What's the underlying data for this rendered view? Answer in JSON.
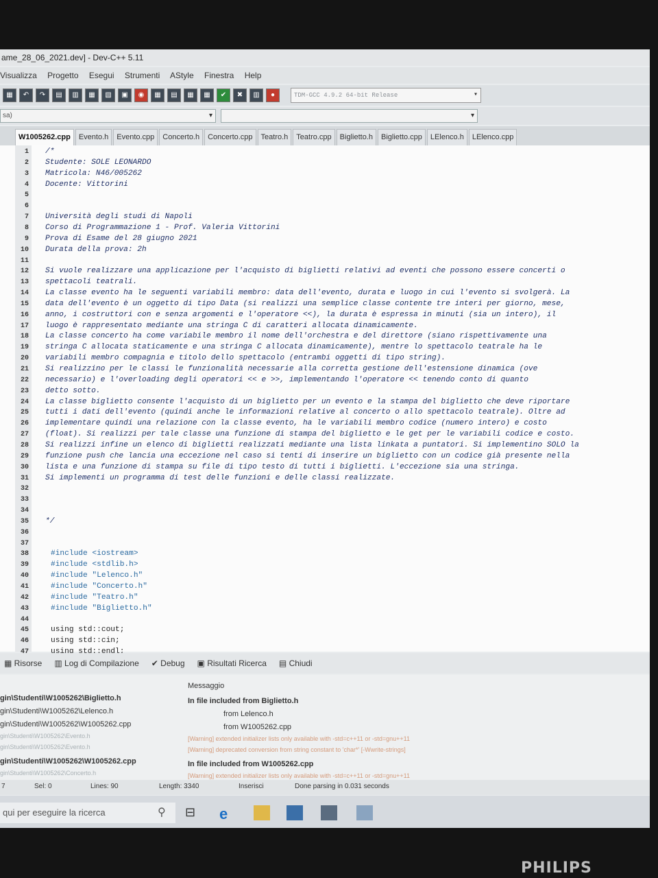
{
  "window": {
    "title": "ame_28_06_2021.dev] - Dev-C++ 5.11"
  },
  "menu": [
    "Visualizza",
    "Progetto",
    "Esegui",
    "Strumenti",
    "AStyle",
    "Finestra",
    "Help"
  ],
  "toolbar": {
    "compiler": "TDM-GCC 4.9.2 64-bit Release"
  },
  "selector": {
    "left_value": "sa)"
  },
  "tabs": [
    "W1005262.cpp",
    "Evento.h",
    "Evento.cpp",
    "Concerto.h",
    "Concerto.cpp",
    "Teatro.h",
    "Teatro.cpp",
    "Biglietto.h",
    "Biglietto.cpp",
    "LElenco.h",
    "LElenco.cpp"
  ],
  "editor": {
    "lines": [
      {
        "n": "1",
        "text": "/*"
      },
      {
        "n": "2",
        "text": "Studente: SOLE LEONARDO"
      },
      {
        "n": "3",
        "text": "Matricola: N46/005262"
      },
      {
        "n": "4",
        "text": "Docente: Vittorini"
      },
      {
        "n": "5",
        "text": ""
      },
      {
        "n": "6",
        "text": ""
      },
      {
        "n": "7",
        "text": "Università degli studi di Napoli"
      },
      {
        "n": "8",
        "text": "Corso di Programmazione 1 - Prof. Valeria Vittorini"
      },
      {
        "n": "9",
        "text": "Prova di Esame del 28 giugno 2021"
      },
      {
        "n": "10",
        "text": "Durata della prova: 2h"
      },
      {
        "n": "11",
        "text": ""
      },
      {
        "n": "12",
        "text": "Si vuole realizzare una applicazione per l'acquisto di biglietti relativi ad eventi che possono essere concerti o"
      },
      {
        "n": "13",
        "text": "spettacoli teatrali."
      },
      {
        "n": "14",
        "text": "La classe evento ha le seguenti variabili membro: data dell'evento, durata e luogo in cui l'evento si svolgerà. La"
      },
      {
        "n": "15",
        "text": "data dell'evento è un oggetto di tipo Data (si realizzi una semplice classe contente tre interi per giorno, mese,"
      },
      {
        "n": "16",
        "text": "anno, i costruttori con e senza argomenti e l'operatore <<), la durata è espressa in minuti (sia un intero), il"
      },
      {
        "n": "17",
        "text": "luogo è rappresentato mediante una stringa C di caratteri allocata dinamicamente."
      },
      {
        "n": "18",
        "text": "La classe concerto ha come variabile membro il nome dell'orchestra e del direttore (siano rispettivamente una"
      },
      {
        "n": "19",
        "text": "stringa C allocata staticamente e una stringa C allocata dinamicamente), mentre lo spettacolo teatrale ha le"
      },
      {
        "n": "20",
        "text": "variabili membro compagnia e titolo dello spettacolo (entrambi oggetti di tipo string)."
      },
      {
        "n": "21",
        "text": "Si realizzino per le classi le funzionalità necessarie alla corretta gestione dell'estensione dinamica (ove"
      },
      {
        "n": "22",
        "text": "necessario) e l'overloading degli operatori << e >>, implementando l'operatore << tenendo conto di quanto"
      },
      {
        "n": "23",
        "text": "detto sotto."
      },
      {
        "n": "24",
        "text": "La classe biglietto consente l'acquisto di un biglietto per un evento e la stampa del biglietto che deve riportare"
      },
      {
        "n": "25",
        "text": "tutti i dati dell'evento (quindi anche le informazioni relative al concerto o allo spettacolo teatrale). Oltre ad"
      },
      {
        "n": "26",
        "text": "implementare quindi una relazione con la classe evento, ha le variabili membro codice (numero intero) e costo"
      },
      {
        "n": "27",
        "text": "(float). Si realizzi per tale classe una funzione di stampa del biglietto e le get per le variabili codice e costo."
      },
      {
        "n": "28",
        "text": "Si realizzi infine un elenco di biglietti realizzati mediante una lista linkata a puntatori. Si implementino SOLO la"
      },
      {
        "n": "29",
        "text": "funzione push che lancia una eccezione nel caso si tenti di inserire un biglietto con un codice già presente nella"
      },
      {
        "n": "30",
        "text": "lista e una funzione di stampa su file di tipo testo di tutti i biglietti. L'eccezione sia una stringa."
      },
      {
        "n": "31",
        "text": "Si implementi un programma di test delle funzioni e delle classi realizzate."
      },
      {
        "n": "32",
        "text": ""
      },
      {
        "n": "33",
        "text": ""
      },
      {
        "n": "34",
        "text": ""
      },
      {
        "n": "35",
        "text": "*/"
      },
      {
        "n": "36",
        "text": ""
      },
      {
        "n": "37",
        "text": ""
      },
      {
        "n": "38",
        "text": "#include <iostream>"
      },
      {
        "n": "39",
        "text": "#include <stdlib.h>"
      },
      {
        "n": "40",
        "text": "#include \"Lelenco.h\""
      },
      {
        "n": "41",
        "text": "#include \"Concerto.h\""
      },
      {
        "n": "42",
        "text": "#include \"Teatro.h\""
      },
      {
        "n": "43",
        "text": "#include \"Biglietto.h\""
      },
      {
        "n": "44",
        "text": ""
      },
      {
        "n": "45",
        "text": "using std::cout;"
      },
      {
        "n": "46",
        "text": "using std::cin;"
      },
      {
        "n": "47",
        "text": "using std::endl;"
      }
    ]
  },
  "bottom_tabs": [
    "Risorse",
    "Log di Compilazione",
    "Debug",
    "Risultati Ricerca",
    "Chiudi"
  ],
  "output": {
    "header": "Messaggio",
    "left": [
      "gin\\Studenti\\W1005262\\Biglietto.h",
      "gin\\Studenti\\W1005262\\Lelenco.h",
      "gin\\Studenti\\W1005262\\W1005262.cpp",
      "gin\\Studenti\\W1005262\\Evento.h",
      "gin\\Studenti\\W1005262\\Evento.h",
      "gin\\Studenti\\W1005262\\W1005262.cpp",
      "gin\\Studenti\\W1005262\\Concerto.h"
    ],
    "right": [
      "In file included from Biglietto.h",
      "from Lelenco.h",
      "from W1005262.cpp",
      "[Warning] extended initializer lists only available with -std=c++11 or -std=gnu++11",
      "[Warning] deprecated conversion from string constant to 'char*' [-Wwrite-strings]",
      "In file included from W1005262.cpp",
      "[Warning] extended initializer lists only available with -std=c++11 or -std=gnu++11"
    ]
  },
  "status": {
    "line": "7",
    "sel": "Sel: 0",
    "lines": "Lines: 90",
    "length": "Length: 3340",
    "mode": "Inserisci",
    "parse": "Done parsing in 0.031 seconds"
  },
  "taskbar": {
    "search_placeholder": "qui per eseguire la ricerca"
  },
  "monitor": {
    "brand": "PHILIPS"
  }
}
